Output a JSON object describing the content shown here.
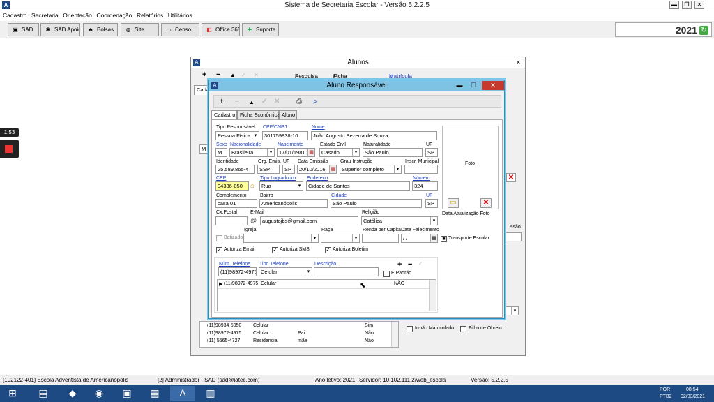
{
  "app": {
    "title": "Sistema de Secretaria Escolar - Versão 5.2.2.5",
    "year": "2021",
    "menu": [
      "Cadastro",
      "Secretaria",
      "Orientação",
      "Coordenação",
      "Relatórios",
      "Utilitários"
    ],
    "toolbar": [
      {
        "label": "SAD",
        "icon": "monitor-icon",
        "glyph": "▣"
      },
      {
        "label": "SAD Apoio",
        "icon": "gear-icon",
        "glyph": "✱"
      },
      {
        "label": "Bolsas",
        "icon": "people-icon",
        "glyph": "♣"
      },
      {
        "label": "Site",
        "icon": "globe-icon",
        "glyph": "◍"
      },
      {
        "label": "Censo",
        "icon": "census-icon",
        "glyph": "▭"
      },
      {
        "label": "Office 365",
        "icon": "office-icon",
        "glyph": "◧"
      },
      {
        "label": "Suporte",
        "icon": "support-icon",
        "glyph": "✚"
      }
    ]
  },
  "recorder": {
    "time": "1:53"
  },
  "alunos_window": {
    "title": "Alunos",
    "toolbar": {
      "pesquisa": "Pesquisa",
      "ficha": "Ficha Cadastral",
      "matricula": "Matrícula"
    },
    "tab_fragment": "Cada",
    "right_fragments": {
      "ssao": "ssão"
    },
    "checks": {
      "irmao": "Irmão Matriculado",
      "filho": "Filho de Obreiro"
    },
    "phones": [
      {
        "num": "(11)98934-5050",
        "tipo": "Celular",
        "desc": "",
        "padrao": "Sim"
      },
      {
        "num": "(11)98972-4975",
        "tipo": "Celular",
        "desc": "Pai",
        "padrao": "Não"
      },
      {
        "num": "(11) 5565-4727",
        "tipo": "Residencial",
        "desc": "mãe",
        "padrao": "Não"
      }
    ]
  },
  "resp": {
    "title": "Aluno Responsável",
    "tabs": [
      "Cadastro",
      "Ficha Econômica",
      "Aluno"
    ],
    "labels": {
      "tipo": "Tipo Responsável",
      "cpf": "CPF/CNPJ",
      "nome": "Nome",
      "sexo": "Sexo",
      "nacionalidade": "Nacionalidade",
      "nascimento": "Nascimento",
      "estado_civil": "Estado Civil",
      "naturalidade": "Naturalidade",
      "uf": "UF",
      "identidade": "Identidade",
      "org": "Org. Emis.",
      "uf2": "UF",
      "data_emissao": "Data Emissão",
      "grau": "Grau Instrução",
      "inscr": "Inscr. Municipal",
      "cep": "CEP",
      "tipo_log": "Tipo Logradouro",
      "endereco": "Endereço",
      "numero": "Número",
      "complemento": "Complemento",
      "bairro": "Bairro",
      "cidade": "Cidade",
      "uf3": "UF",
      "cxpostal": "Cx.Postal",
      "email": "E-Mail",
      "religiao": "Religião",
      "batizado": "Batizado",
      "igreja": "Igreja",
      "raca": "Raça",
      "renda": "Renda per Capita",
      "falecimento": "Data Falecimento",
      "transporte": "Transporte Escolar",
      "aut_email": "Autoriza Email",
      "aut_sms": "Autoriza SMS",
      "aut_boletim": "Autoriza Boletim",
      "num_tel": "Núm. Telefone",
      "tipo_tel": "Tipo Telefone",
      "descricao": "Descrição",
      "padrao": "É Padrão",
      "foto": "Foto",
      "data_foto": "Data Atualização Foto"
    },
    "values": {
      "tipo": "Pessoa Física",
      "cpf": "301759838-10",
      "nome": "João Augusto Bezerra de Souza",
      "sexo": "M",
      "nacionalidade": "Brasileira",
      "nascimento": "17/01/1981",
      "estado_civil": "Casado",
      "naturalidade": "São Paulo",
      "uf": "SP",
      "identidade": "25.589.865-4",
      "org": "SSP",
      "uf2": "SP",
      "data_emissao": "20/10/2016",
      "grau": "Superior completo",
      "inscr": "",
      "cep": "04336-050",
      "tipo_log": "Rua",
      "endereco": "Cidade de Santos",
      "numero": "324",
      "complemento": "casa 01",
      "bairro": "Americanópolis",
      "cidade": "São Paulo",
      "uf3": "SP",
      "cxpostal": "",
      "email": "augustojbs@gmail.com",
      "religiao": "Católica",
      "igreja": "",
      "raca": "",
      "renda": "",
      "falecimento": " / /",
      "num_tel": "(11)98972-4975",
      "tipo_tel": "Celular",
      "descricao": ""
    },
    "phone_rows": [
      {
        "num": "(11)98972-4975",
        "tipo": "Celular",
        "desc": "",
        "padrao": "NÃO"
      }
    ]
  },
  "status": {
    "school": "[102122-401] Escola Adventista de Americanópolis",
    "user": "[2] Administrador - SAD (sad@iatec.com)",
    "ano": "Ano letivo: 2021",
    "servidor": "Servidor: 10.102.111.2/web_escola",
    "versao": "Versão: 5.2.2.5"
  },
  "tray": {
    "lang": "POR",
    "kbd": "PTB2",
    "time": "08:54",
    "date": "02/03/2021"
  }
}
